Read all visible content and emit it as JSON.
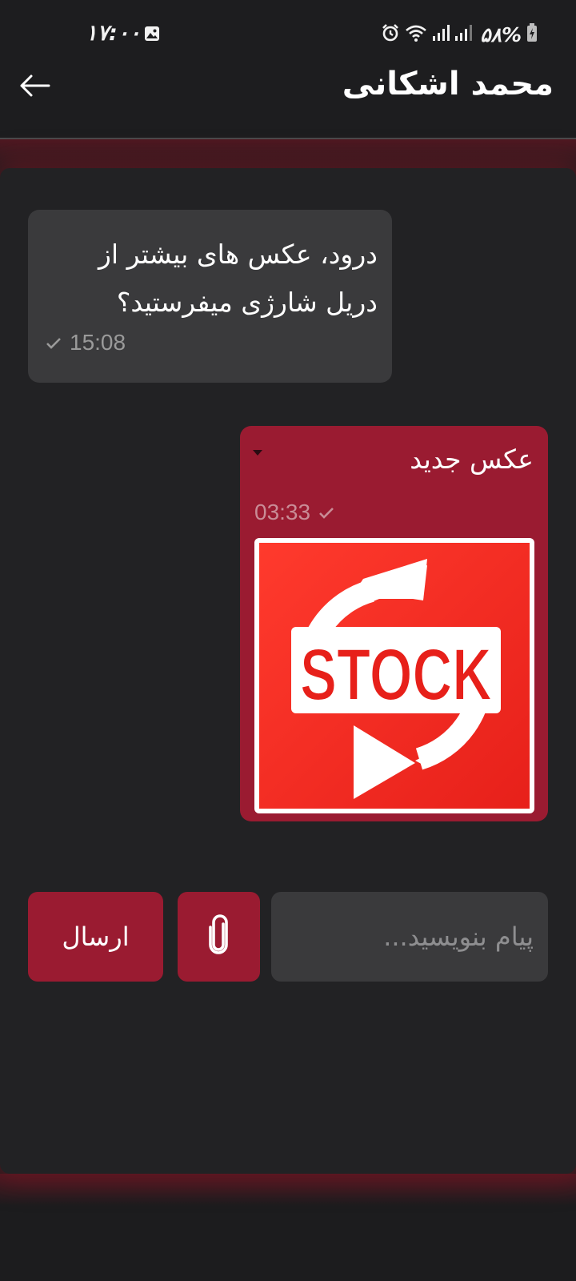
{
  "status_bar": {
    "time": "۱۷:۰۰",
    "battery": "۵۸%",
    "icons": [
      "gallery-icon",
      "alarm-icon",
      "wifi-icon",
      "signal-icon",
      "signal-icon",
      "battery-charging-icon"
    ]
  },
  "header": {
    "contact_name": "محمد اشکانی",
    "back_icon": "arrow-left-icon"
  },
  "messages": [
    {
      "direction": "incoming",
      "text": "درود، عکس های بیشتر از دریل شارژی میفرستید؟",
      "time": "15:08",
      "status_icon": "check-icon"
    },
    {
      "direction": "outgoing",
      "text": "عکس جدید",
      "time": "03:33",
      "status_icon": "check-icon",
      "attachment": {
        "type": "image",
        "image_text": "STOCK"
      }
    }
  ],
  "composer": {
    "placeholder": "پیام بنویسید...",
    "send_label": "ارسال",
    "attach_icon": "paperclip-icon"
  },
  "colors": {
    "accent": "#9a1b31",
    "background": "#1c1c1e",
    "incoming_bubble": "#3a3a3c"
  }
}
